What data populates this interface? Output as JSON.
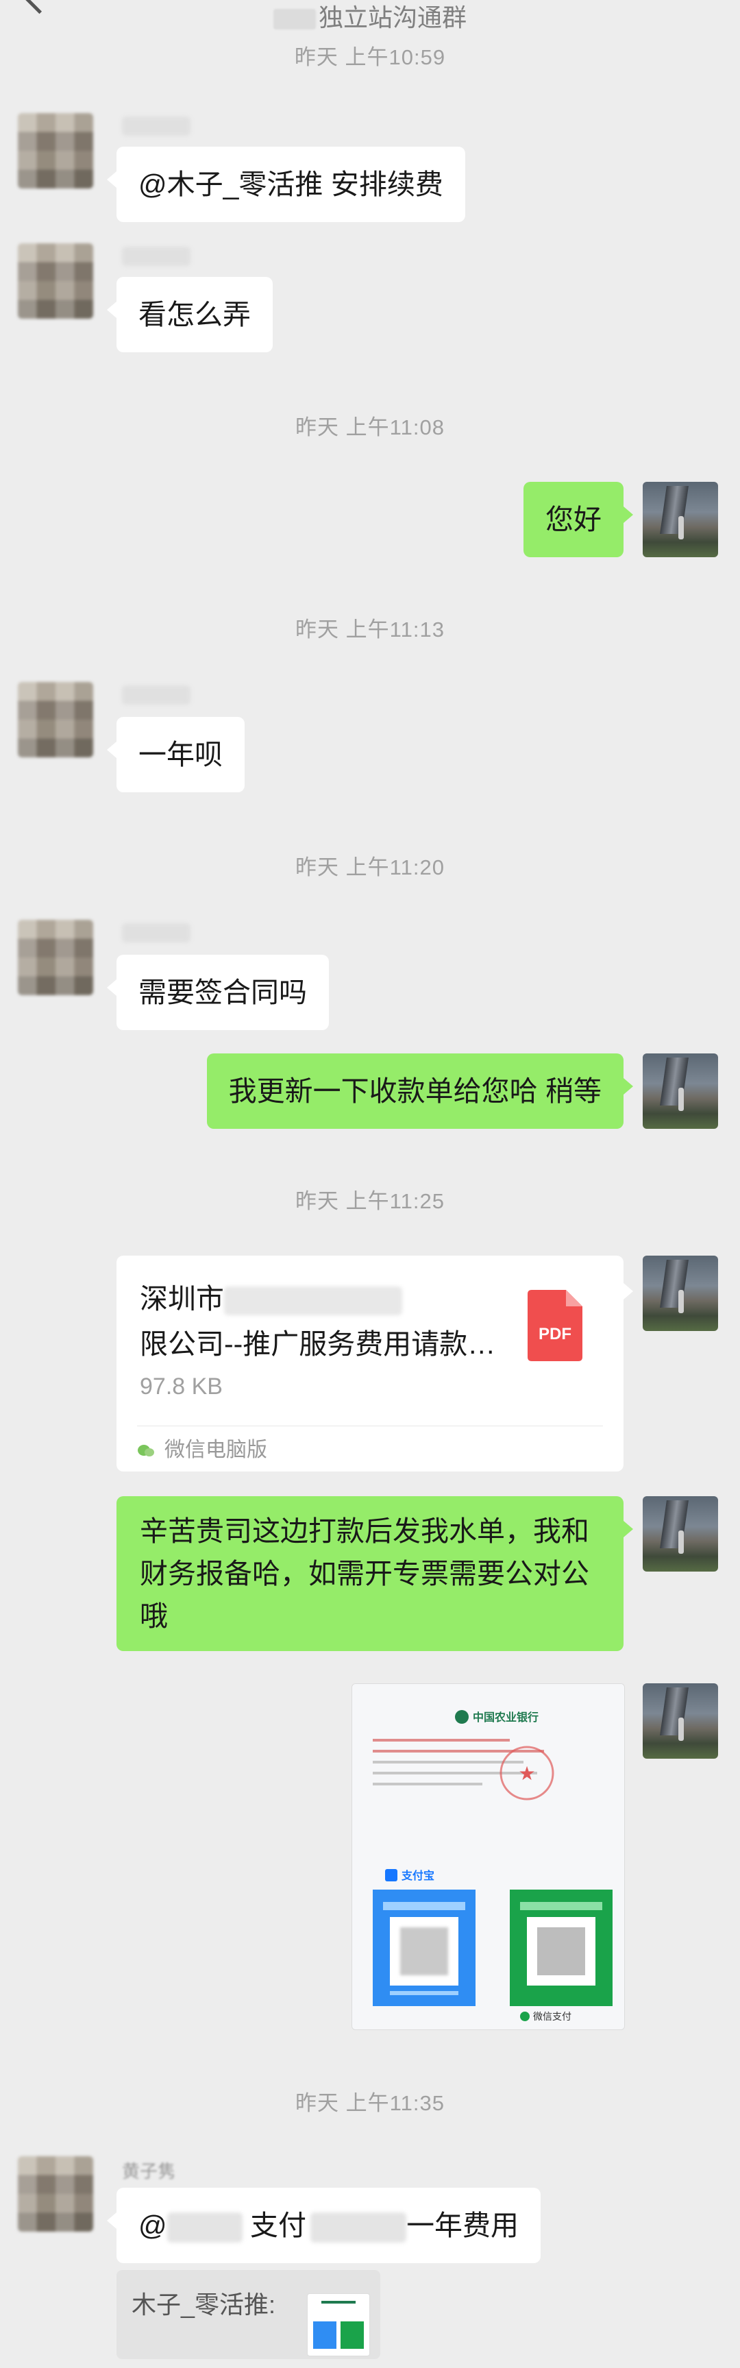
{
  "header": {
    "title_suffix": "独立站沟通群"
  },
  "messages": {
    "m1": {
      "text": "@木子_零活推  安排续费"
    },
    "m2": {
      "text": "看怎么弄"
    },
    "m3": {
      "text": "您好"
    },
    "m4": {
      "text": "一年呗"
    },
    "m5": {
      "text": "需要签合同吗"
    },
    "m6": {
      "text": "我更新一下收款单给您哈 稍等"
    },
    "file": {
      "name_prefix": "深圳市",
      "name_suffix": "限公司--推广服务费用请款…",
      "size": "97.8 KB",
      "source": "微信电脑版",
      "icon_label": "PDF"
    },
    "m7": {
      "text": "辛苦贵司这边打款后发我水单，我和财务报备哈，如需开专票需要公对公哦"
    },
    "image_card": {
      "bank_name": "中国农业银行",
      "alipay_label": "支付宝",
      "wechat_pay_label": "微信支付"
    },
    "m8": {
      "text_at": "@",
      "text_mid": "支付",
      "text_end": "一年费用"
    },
    "quote": {
      "text": "木子_零活推:"
    },
    "last_sender_name": "黄子隽"
  },
  "timestamps": {
    "t1": "昨天 上午10:59",
    "t2": "昨天 上午11:08",
    "t3": "昨天 上午11:13",
    "t4": "昨天 上午11:20",
    "t5": "昨天 上午11:25",
    "t6": "昨天 上午11:35"
  },
  "colors": {
    "background": "#EDEDED",
    "bubble_self": "#95EC69",
    "bubble_other": "#FFFFFF",
    "pdf_red": "#F04E4E"
  }
}
